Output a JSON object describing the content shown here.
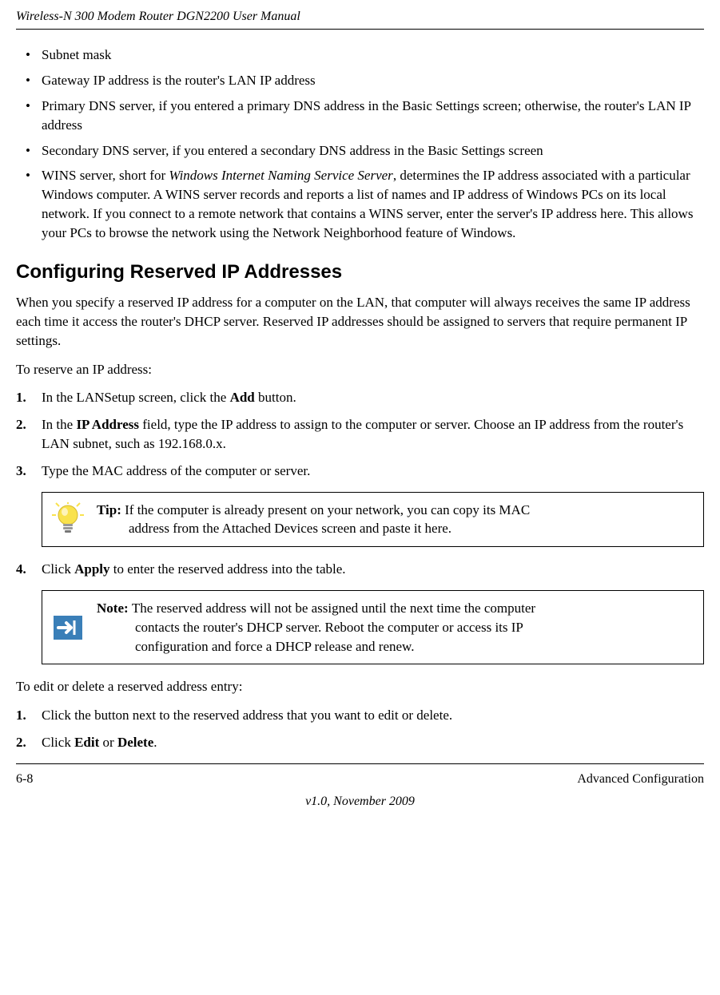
{
  "header": {
    "title": "Wireless-N 300 Modem Router DGN2200 User Manual"
  },
  "bullets": {
    "b1": "Subnet mask",
    "b2": "Gateway IP address is the router's LAN IP address",
    "b3": "Primary DNS server, if you entered a primary DNS address in the Basic Settings screen; otherwise, the router's LAN IP address",
    "b4": "Secondary DNS server, if you entered a secondary DNS address in the Basic Settings screen",
    "b5_pre": "WINS server, short for ",
    "b5_italic": "Windows Internet Naming Service Server",
    "b5_post": ", determines the IP address associated with a particular Windows computer. A WINS server records and reports a list of names and IP address of Windows PCs on its local network. If you connect to a remote network that contains a WINS server, enter the server's IP address here. This allows your PCs to browse the network using the Network Neighborhood feature of Windows."
  },
  "section": {
    "title": "Configuring Reserved IP Addresses",
    "intro": "When you specify a reserved IP address for a computer on the LAN, that computer will always receives the same IP address each time it access the router's DHCP server. Reserved IP addresses should be assigned to servers that require permanent IP settings.",
    "reserve_lead": "To reserve an IP address:"
  },
  "steps1": {
    "s1_pre": "In the LANSetup screen, click the ",
    "s1_bold": "Add",
    "s1_post": " button.",
    "s2_pre": "In the ",
    "s2_bold": "IP Address",
    "s2_post": " field, type the IP address to assign to the computer or server. Choose an IP address from the router's LAN subnet, such as 192.168.0.x.",
    "s3": "Type the MAC address of the computer or server."
  },
  "tip": {
    "label": "Tip: ",
    "text_first": "If the computer is already present on your network, you can copy its MAC",
    "text_cont": "address from the Attached Devices screen and paste it here."
  },
  "steps1b": {
    "s4_pre": "Click ",
    "s4_bold": "Apply",
    "s4_post": " to enter the reserved address into the table."
  },
  "note": {
    "label": "Note: ",
    "text_first": "The reserved address will not be assigned until the next time the computer",
    "text_cont1": "contacts the router's DHCP server. Reboot the computer or access its IP",
    "text_cont2": "configuration and force a DHCP release and renew."
  },
  "edit_lead": "To edit or delete a reserved address entry:",
  "steps2": {
    "s1": "Click the button next to the reserved address that you want to edit or delete.",
    "s2_pre": "Click ",
    "s2_bold1": "Edit",
    "s2_mid": " or ",
    "s2_bold2": "Delete",
    "s2_post": "."
  },
  "footer": {
    "page_num": "6-8",
    "section_name": "Advanced Configuration",
    "version": "v1.0, November 2009"
  }
}
